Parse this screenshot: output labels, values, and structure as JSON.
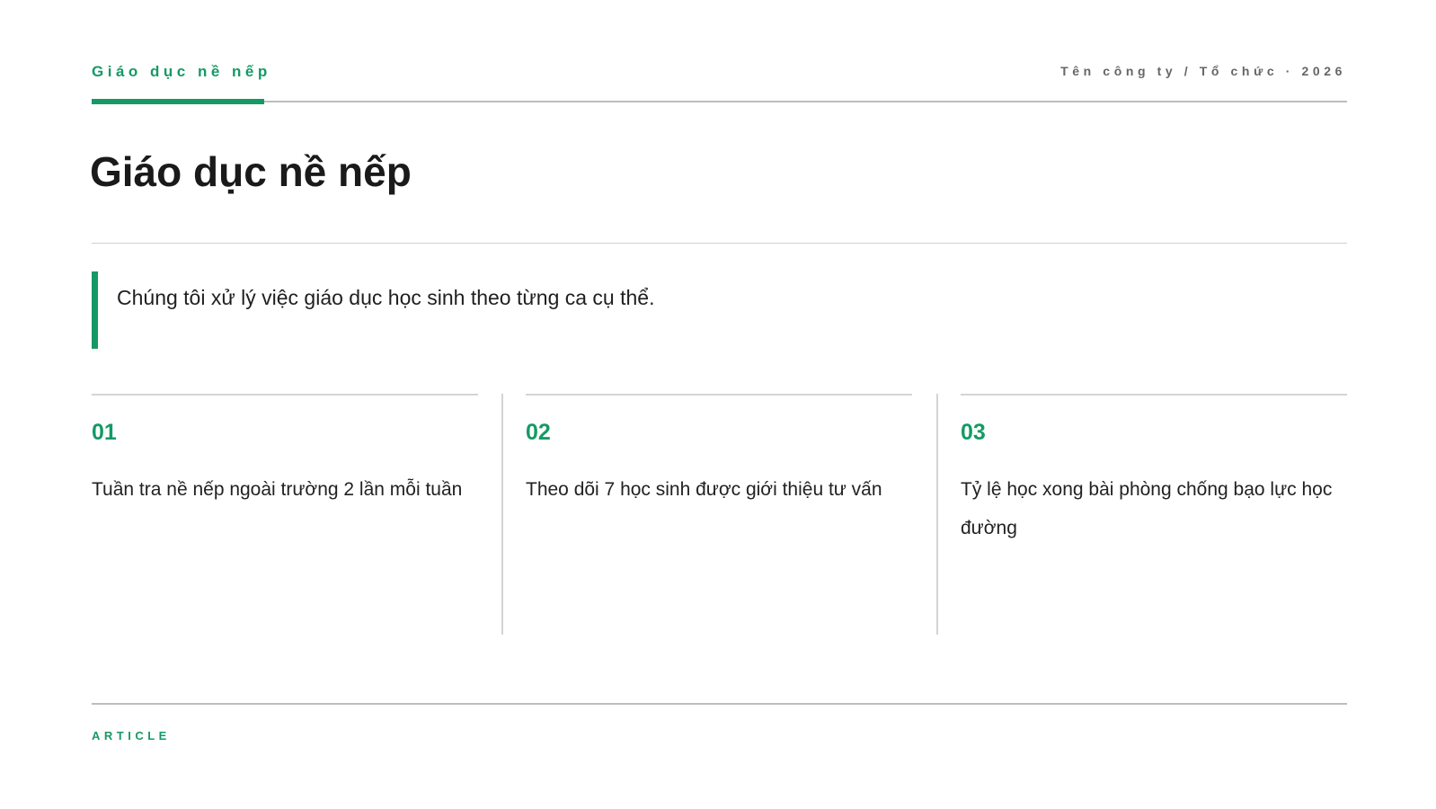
{
  "header": {
    "kicker": "Giáo dục nề nếp",
    "org": "Tên công ty / Tổ chức · 2026"
  },
  "title": "Giáo dục nề nếp",
  "lead": "Chúng tôi xử lý việc giáo dục học sinh theo từng ca cụ thể.",
  "items": [
    {
      "num": "01",
      "text": "Tuần tra nề nếp ngoài trường 2 lần mỗi tuần"
    },
    {
      "num": "02",
      "text": "Theo dõi 7 học sinh được giới thiệu tư vấn"
    },
    {
      "num": "03",
      "text": "Tỷ lệ học xong bài phòng chống bạo lực học đường"
    }
  ],
  "footer": {
    "label": "ARTICLE"
  },
  "colors": {
    "accent": "#159a65",
    "text": "#1a1a1a",
    "muted": "#666666",
    "rule": "#bdbdbd"
  }
}
